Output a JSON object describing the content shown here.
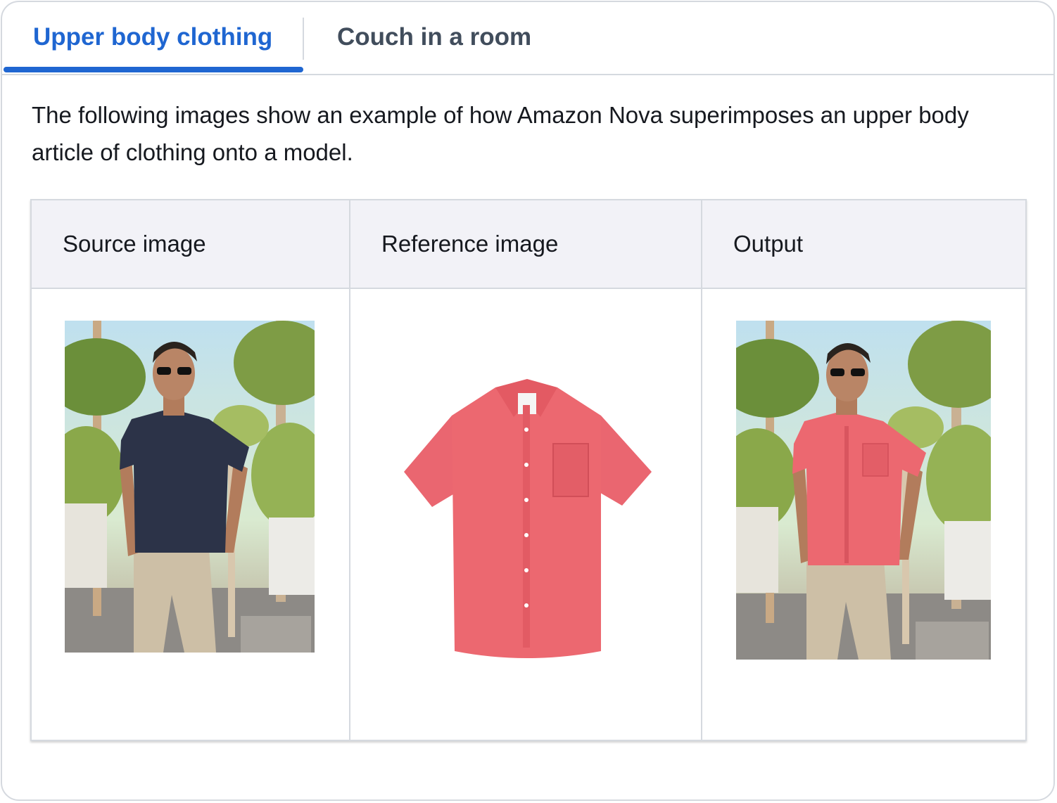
{
  "tabs": [
    {
      "label": "Upper body clothing",
      "active": true
    },
    {
      "label": "Couch in a room",
      "active": false
    }
  ],
  "description": "The following images show an example of how Amazon Nova superimposes an upper body article of clothing onto a model.",
  "table": {
    "headers": [
      "Source image",
      "Reference image",
      "Output"
    ],
    "cells": [
      {
        "image": "man-in-navy-tshirt-photo"
      },
      {
        "image": "pink-short-sleeve-shirt-photo"
      },
      {
        "image": "man-in-pink-shirt-photo"
      }
    ]
  },
  "colors": {
    "accent": "#1f66d1",
    "header_bg": "#f2f2f7",
    "border": "#d5d9df",
    "shirt_pink": "#ec6870",
    "tshirt_navy": "#2c3348"
  }
}
